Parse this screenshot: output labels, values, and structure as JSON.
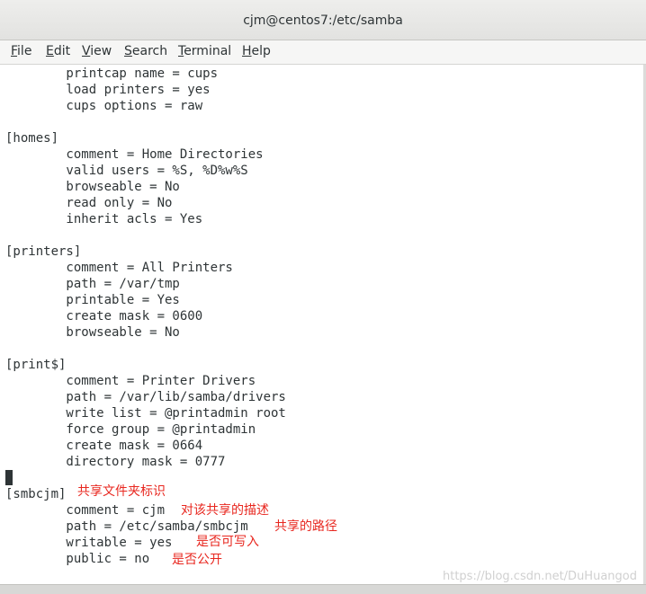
{
  "window": {
    "title": "cjm@centos7:/etc/samba"
  },
  "menu": [
    {
      "mnemonic": "F",
      "rest": "ile"
    },
    {
      "mnemonic": "E",
      "rest": "dit"
    },
    {
      "mnemonic": "V",
      "rest": "iew"
    },
    {
      "mnemonic": "S",
      "rest": "earch"
    },
    {
      "mnemonic": "T",
      "rest": "erminal"
    },
    {
      "mnemonic": "H",
      "rest": "elp"
    }
  ],
  "terminal": {
    "lines": [
      "        printcap name = cups",
      "        load printers = yes",
      "        cups options = raw",
      "",
      "[homes]",
      "        comment = Home Directories",
      "        valid users = %S, %D%w%S",
      "        browseable = No",
      "        read only = No",
      "        inherit acls = Yes",
      "",
      "[printers]",
      "        comment = All Printers",
      "        path = /var/tmp",
      "        printable = Yes",
      "        create mask = 0600",
      "        browseable = No",
      "",
      "[print$]",
      "        comment = Printer Drivers",
      "        path = /var/lib/samba/drivers",
      "        write list = @printadmin root",
      "        force group = @printadmin",
      "        create mask = 0664",
      "        directory mask = 0777",
      "",
      "[smbcjm]",
      "        comment = cjm",
      "        path = /etc/samba/smbcjm",
      "        writable = yes",
      "        public = no"
    ],
    "annotations": [
      "共享文件夹标识",
      "对该共享的描述",
      "共享的路径",
      "是否可写入",
      "是否公开"
    ]
  },
  "watermark": "https://blog.csdn.net/DuHuangod",
  "colors": {
    "annotation": "#e8271f",
    "terminal_text": "#2e3436",
    "terminal_bg": "#ffffff"
  }
}
